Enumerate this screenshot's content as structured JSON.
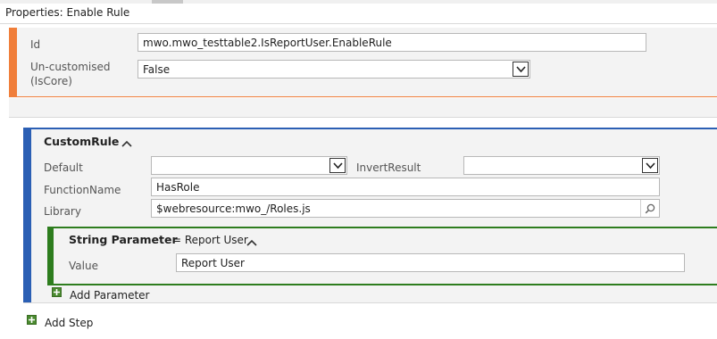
{
  "window": {
    "title": "Properties: Enable Rule"
  },
  "properties": {
    "id_label": "Id",
    "id_value": "mwo.mwo_testtable2.IsReportUser.EnableRule",
    "uncustomised_label_line1": "Un-customised",
    "uncustomised_label_line2": "(IsCore)",
    "uncustomised_value": "False"
  },
  "custom_rule": {
    "title": "CustomRule",
    "default_label": "Default",
    "default_value": "",
    "invert_label": "InvertResult",
    "invert_value": "",
    "function_label": "FunctionName",
    "function_value": "HasRole",
    "library_label": "Library",
    "library_value": "$webresource:mwo_/Roles.js"
  },
  "string_parameter": {
    "title": "String Parameter",
    "subtitle": "= Report User",
    "value_label": "Value",
    "value": "Report User"
  },
  "actions": {
    "add_parameter": "Add Parameter",
    "add_step": "Add Step"
  },
  "colors": {
    "orange_accent": "#f07e3a",
    "blue_accent": "#2b5fb4",
    "green_accent": "#2e7d1e",
    "plus_green": "#4a8a2f"
  },
  "icons": {
    "dropdown": "chevron-down-icon",
    "collapse": "chevron-up-icon",
    "search": "search-icon",
    "add": "plus-icon"
  }
}
